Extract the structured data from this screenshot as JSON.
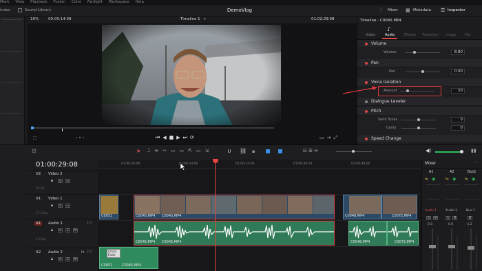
{
  "menu": {
    "items": [
      "Mark",
      "View",
      "Playback",
      "Fusion",
      "Color",
      "Fairlight",
      "Workspace",
      "Help"
    ]
  },
  "topbar": {
    "left_tab": "index",
    "sound_library": "Sound Library",
    "project_title": "DemoVlog",
    "mixer": "Mixer",
    "metadata": "Metadata",
    "inspector": "Inspector"
  },
  "viewer": {
    "zoom": "16%",
    "source_timecode": "00:05:14:09",
    "timeline_name": "Timeline 1",
    "record_timecode": "01:02:29:08"
  },
  "inspector": {
    "title": "Timeline - C0045.MP4",
    "tabs": [
      "Video",
      "Audio",
      "Effects",
      "Transition",
      "Image",
      "File"
    ],
    "sections": {
      "volume": "Volume",
      "volume_param": "Volume",
      "volume_value": "8.80",
      "pan": "Pan",
      "pan_param": "Pan",
      "pan_value": "0.00",
      "voice_isolation": "Voice Isolation",
      "amount_param": "Amount",
      "amount_value": "20",
      "dialogue_leveler": "Dialogue Leveler",
      "pitch": "Pitch",
      "semi_tones": "Semi Tones",
      "semi_tones_value": "0",
      "cents": "Cents",
      "cents_value": "0",
      "speed_change": "Speed Change"
    },
    "annotation_color": "#e03a3a"
  },
  "timeline": {
    "timecode": "01:00:29:08",
    "ruler_ticks": [
      "01:00:16:00",
      "01:00:24:00",
      "01:00:32:00",
      "01:00:40:00",
      "01:00:48:00"
    ],
    "tracks": {
      "v2": {
        "id": "V2",
        "name": "Video 2",
        "count": "0 Clip"
      },
      "v1": {
        "id": "V1",
        "name": "Video 1",
        "count": "17 Clips"
      },
      "a1": {
        "id": "A1",
        "name": "Audio 1",
        "level": "2.0",
        "count": "4 Clips"
      },
      "a2": {
        "id": "A2",
        "name": "Audio 2",
        "fx": "fx",
        "level": "2.0"
      }
    },
    "clips": {
      "v_small": "C0051",
      "v_main_1": "C0045.MP4",
      "v_main_2": "C0045.MP4",
      "v_right_1": "C0048.MP4",
      "v_right_2": "C0072.MP4",
      "a_main_1": "C0045.MP4",
      "a_main_2": "C0045.MP4",
      "a_right_1": "C0048.MP4",
      "a_right_2": "C0072.MP4",
      "a2_1": "C0051",
      "a2_2": "C0045.MP4",
      "cross_fade": "Cross Fade"
    },
    "colors": {
      "video_clip": "#2c4a66",
      "audio_clip": "#2f7a57",
      "playhead": "#e8453c",
      "selection": "#e03a3a"
    }
  },
  "mixer": {
    "title": "Mixer",
    "channels": [
      "A1",
      "A2",
      "Bus1"
    ],
    "strip_labels": [
      "Audio 1",
      "Audio 2",
      "Bus 1"
    ],
    "db_values": [
      "0.0",
      "0.0",
      "-1.2"
    ]
  }
}
